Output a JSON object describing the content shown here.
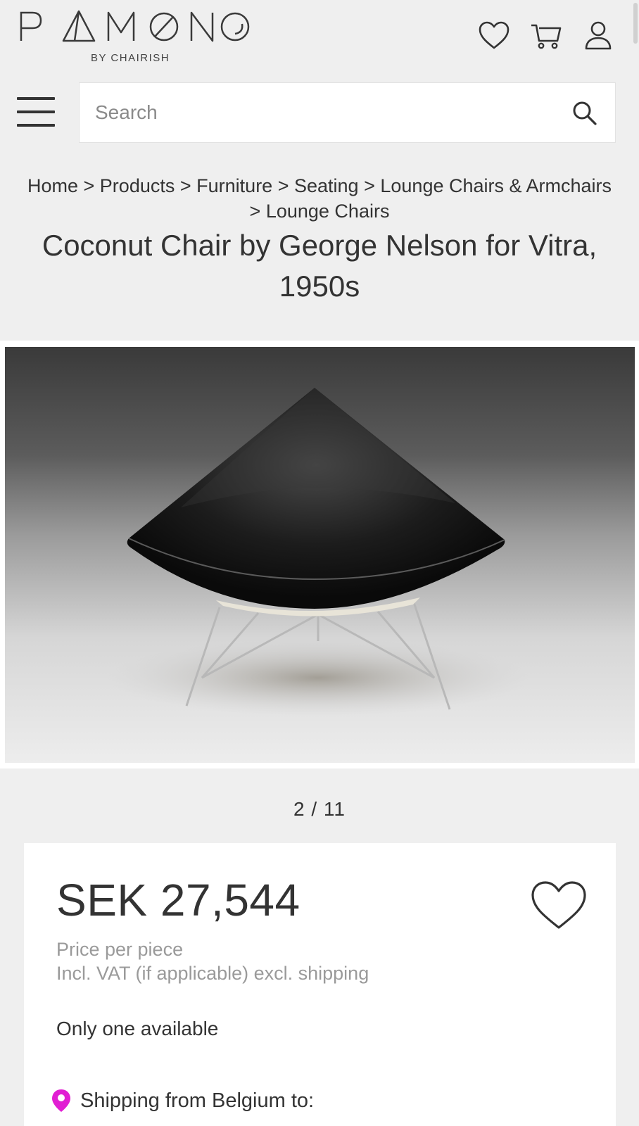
{
  "header": {
    "logo_text": "PAMONO",
    "logo_sub": "BY CHAIRISH",
    "icons": [
      "heart-icon",
      "cart-icon",
      "user-icon"
    ]
  },
  "search": {
    "placeholder": "Search"
  },
  "breadcrumb": {
    "items": [
      "Home",
      "Products",
      "Furniture",
      "Seating",
      "Lounge Chairs & Armchairs",
      "Lounge Chairs"
    ],
    "separator": ">"
  },
  "product": {
    "title": "Coconut Chair by George Nelson for Vitra, 1950s",
    "image_counter": "2 / 11",
    "price": "SEK 27,544",
    "price_per": "Price per piece",
    "vat_note": "Incl. VAT (if applicable) excl. shipping",
    "availability": "Only one available",
    "shipping": "Shipping from Belgium to:"
  },
  "colors": {
    "background": "#efefef",
    "text": "#333333",
    "muted": "#9a9a9a",
    "location_pin": "#e11fd3"
  }
}
